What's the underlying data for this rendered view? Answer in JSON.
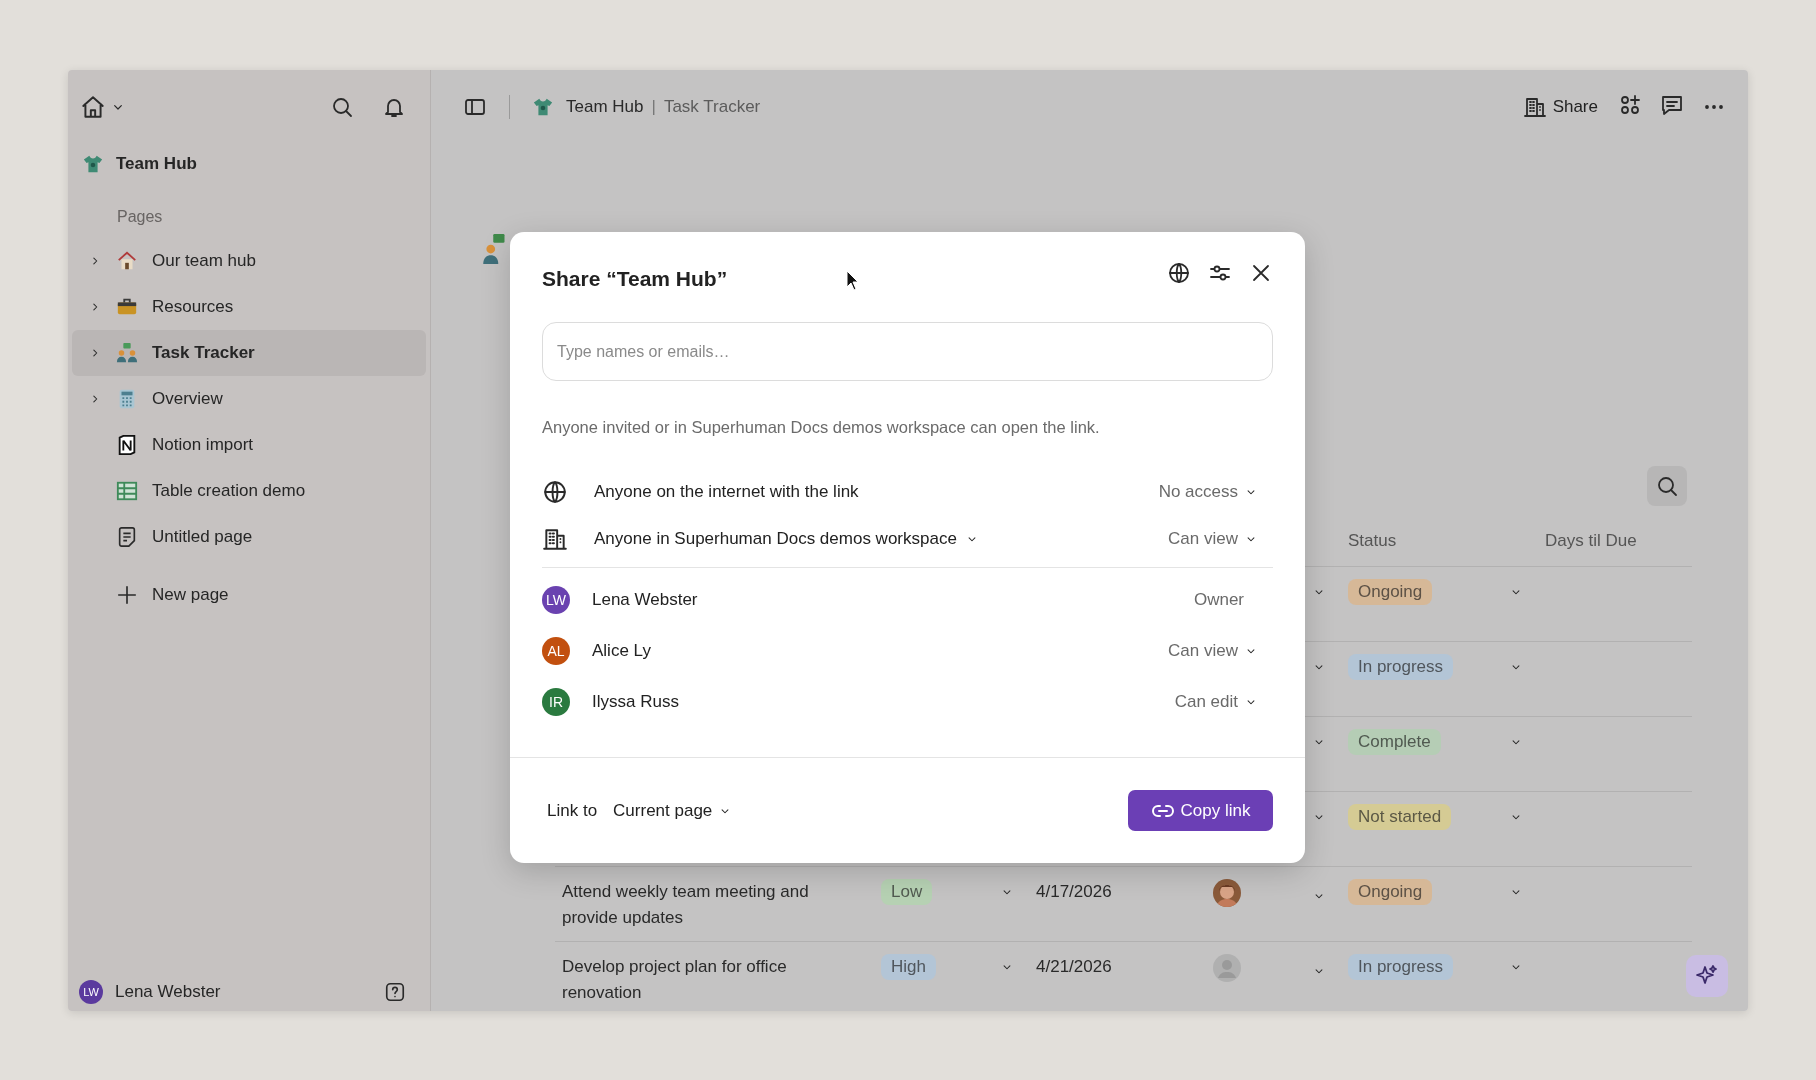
{
  "sidebar": {
    "workspace": "Team Hub",
    "section": "Pages",
    "items": [
      {
        "label": "Our team hub",
        "expanded": false,
        "selected": false
      },
      {
        "label": "Resources",
        "expanded": false,
        "selected": false
      },
      {
        "label": "Task Tracker",
        "expanded": false,
        "selected": true
      },
      {
        "label": "Overview",
        "expanded": false,
        "selected": false
      },
      {
        "label": "Notion import",
        "selected": false
      },
      {
        "label": "Table creation demo",
        "selected": false
      },
      {
        "label": "Untitled page",
        "selected": false
      }
    ],
    "new_page": "New page",
    "user": {
      "initials": "LW",
      "name": "Lena Webster",
      "color": "#5b3a9e"
    }
  },
  "topbar": {
    "breadcrumb": [
      "Team Hub",
      "Task Tracker"
    ],
    "separator": "|",
    "share": "Share"
  },
  "table": {
    "headers": {
      "status": "Status",
      "days_til_due": "Days til Due"
    },
    "rows": [
      {
        "status": {
          "label": "Ongoing",
          "color": "#d6b897"
        }
      },
      {
        "status": {
          "label": "In progress",
          "color": "#b3c5d6"
        }
      },
      {
        "status": {
          "label": "Complete",
          "color": "#b5cdb5"
        }
      },
      {
        "status": {
          "label": "Not started",
          "color": "#d5cb94"
        }
      },
      {
        "task": "Attend weekly team meeting and provide updates",
        "priority": {
          "label": "Low",
          "color": "#b6d1b3"
        },
        "due": "4/17/2026",
        "status": {
          "label": "Ongoing",
          "color": "#d6b897"
        }
      },
      {
        "task": "Develop project plan for office renovation",
        "priority": {
          "label": "High",
          "color": "#b3c5d6"
        },
        "due": "4/21/2026",
        "assignee": {
          "kind": "placeholder"
        },
        "status": {
          "label": "In progress",
          "color": "#b3c5d6"
        }
      }
    ]
  },
  "dialog": {
    "title": "Share “Team Hub”",
    "placeholder": "Type names or emails…",
    "note": "Anyone invited or in Superhuman Docs demos workspace can open the link.",
    "general_access": [
      {
        "kind": "internet",
        "label": "Anyone on the internet with the link",
        "permission": "No access"
      },
      {
        "kind": "workspace",
        "label": "Anyone in Superhuman Docs demos workspace",
        "permission": "Can view"
      }
    ],
    "people": [
      {
        "initials": "LW",
        "name": "Lena Webster",
        "permission": "Owner",
        "editable": false,
        "color": "#6a42b0"
      },
      {
        "initials": "AL",
        "name": "Alice Ly",
        "permission": "Can view",
        "editable": true,
        "color": "#c2500f"
      },
      {
        "initials": "IR",
        "name": "Ilyssa Russ",
        "permission": "Can edit",
        "editable": true,
        "color": "#2a7a3f"
      }
    ],
    "link_to": "Link to",
    "link_target": "Current page",
    "copy": "Copy link"
  }
}
